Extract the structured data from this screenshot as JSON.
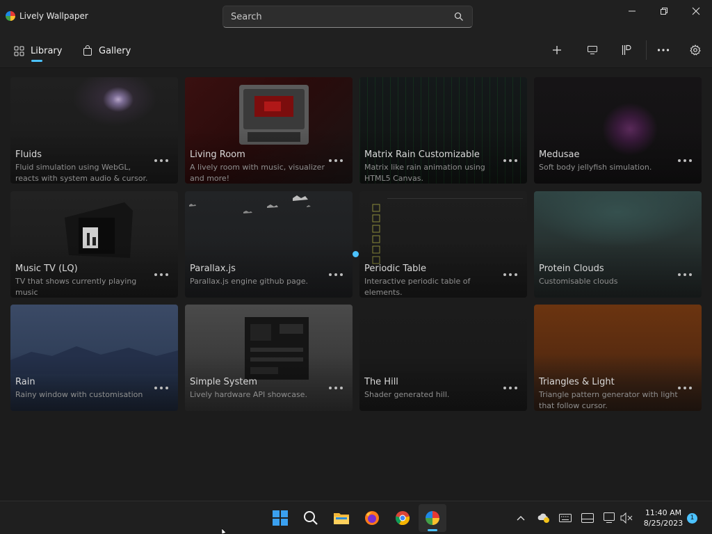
{
  "window": {
    "title": "Lively Wallpaper",
    "search_placeholder": "Search"
  },
  "nav": {
    "library": "Library",
    "gallery": "Gallery"
  },
  "wallpapers": [
    {
      "title": "Fluids",
      "desc": "Fluid simulation using WebGL, reacts with system audio & cursor."
    },
    {
      "title": "Living Room",
      "desc": "A lively room with music, visualizer and more!"
    },
    {
      "title": "Matrix Rain Customizable",
      "desc": "Matrix like rain animation using HTML5 Canvas."
    },
    {
      "title": "Medusae",
      "desc": "Soft body jellyfish simulation."
    },
    {
      "title": "Music TV (LQ)",
      "desc": "TV that shows currently playing music"
    },
    {
      "title": "Parallax.js",
      "desc": "Parallax.js engine github page."
    },
    {
      "title": "Periodic Table",
      "desc": "Interactive periodic table of elements."
    },
    {
      "title": "Protein Clouds",
      "desc": "Customisable clouds"
    },
    {
      "title": "Rain",
      "desc": "Rainy window with customisation"
    },
    {
      "title": "Simple System",
      "desc": "Lively hardware API showcase."
    },
    {
      "title": "The Hill",
      "desc": "Shader generated hill."
    },
    {
      "title": "Triangles & Light",
      "desc": "Triangle pattern generator with light that follow cursor."
    }
  ],
  "taskbar": {
    "time": "11:40 AM",
    "date": "8/25/2023",
    "notification_count": "1"
  },
  "colors": {
    "accent": "#4cc2ff",
    "background": "#1c1c1c"
  }
}
